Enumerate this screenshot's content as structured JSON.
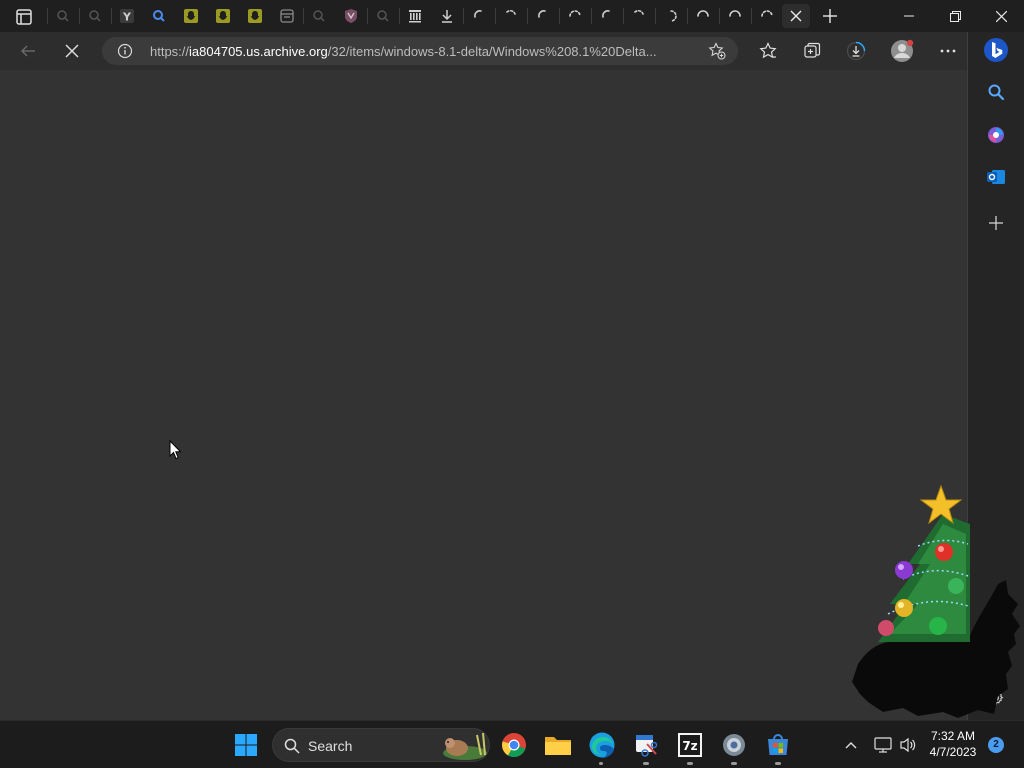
{
  "browser": {
    "url_prefix": "https://",
    "url_host": "ia804705.us.archive.org",
    "url_path": "/32/items/windows-8.1-delta/Windows%208.1%20Delta..."
  },
  "taskbar": {
    "search_label": "Search",
    "time": "7:32 AM",
    "date": "4/7/2023",
    "notification_count": "2"
  },
  "colors": {
    "accent": "#2aa7ff",
    "tab_bg": "#1f1f1f",
    "toolbar_bg": "#2d2d2d",
    "content_bg": "#333333"
  }
}
